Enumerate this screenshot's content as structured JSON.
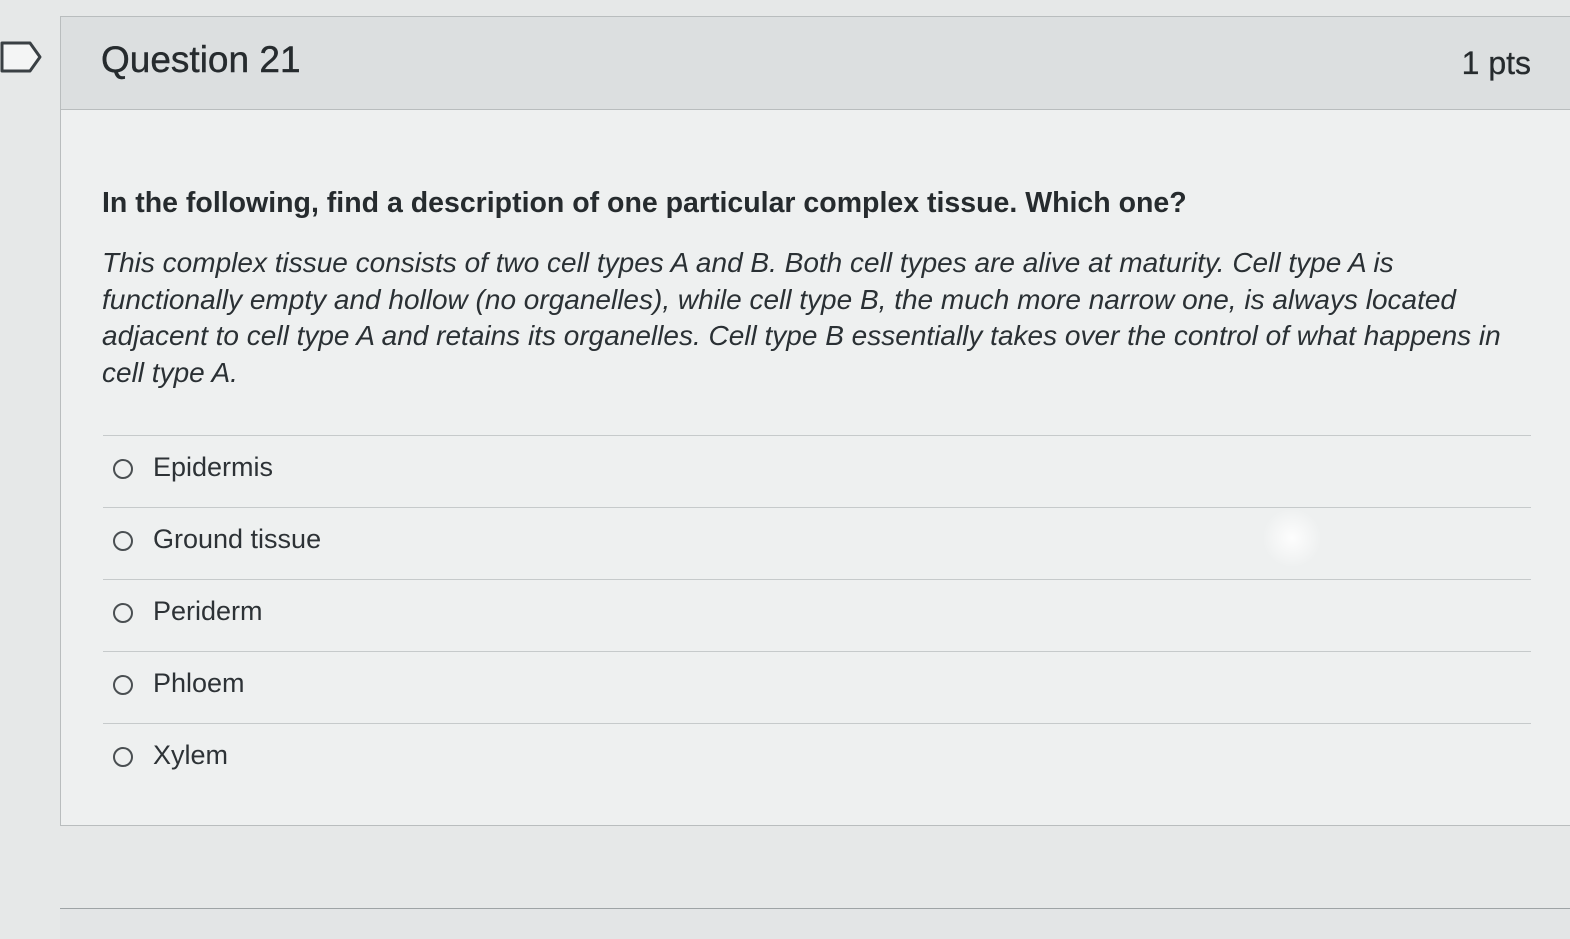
{
  "question": {
    "title": "Question 21",
    "points": "1 pts",
    "prompt": "In the following, find a description of one particular complex tissue. Which one?",
    "description": "This complex tissue consists of two cell types A and B. Both cell types are alive at maturity.  Cell type A is functionally empty and hollow (no organelles), while cell type B, the much more narrow one, is always located adjacent to cell type A and retains its organelles. Cell type B essentially takes over the control of what happens in cell type A.",
    "answers": [
      {
        "label": "Epidermis",
        "selected": false
      },
      {
        "label": "Ground tissue",
        "selected": false
      },
      {
        "label": "Periderm",
        "selected": false
      },
      {
        "label": "Phloem",
        "selected": false
      },
      {
        "label": "Xylem",
        "selected": false
      }
    ]
  },
  "icons": {
    "flag": "flag-question-icon"
  },
  "colors": {
    "header_bg": "#dcdfe0",
    "card_bg": "#eef0f0",
    "text": "#262b2e"
  }
}
